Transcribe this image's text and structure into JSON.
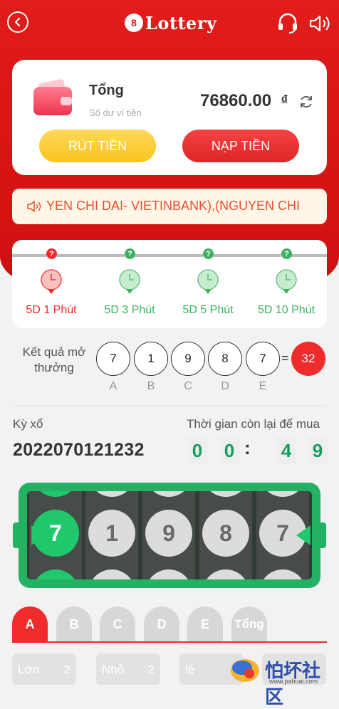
{
  "app": {
    "logo_mark": "8",
    "logo_text": "Lottery"
  },
  "wallet": {
    "title": "Tổng",
    "subtitle": "Số dư ví tiền",
    "balance": "76860.00",
    "currency": "đ",
    "withdraw_label": "RÚT TIỀN",
    "deposit_label": "NẠP TIỀN"
  },
  "notice": {
    "text": "YEN CHI DAI- VIETINBANK),(NGUYEN CHI"
  },
  "modes": [
    {
      "label": "5D 1 Phút",
      "active": true
    },
    {
      "label": "5D 3 Phút",
      "active": false
    },
    {
      "label": "5D 5 Phút",
      "active": false
    },
    {
      "label": "5D 10 Phút",
      "active": false
    }
  ],
  "modes_q": "?",
  "result": {
    "label": "Kết quả mở thưởng",
    "balls": [
      "7",
      "1",
      "9",
      "8",
      "7"
    ],
    "letters": [
      "A",
      "B",
      "C",
      "D",
      "E"
    ],
    "equals": "=",
    "sum": "32"
  },
  "period": {
    "label": "Kỳ xổ",
    "value": "2022070121232"
  },
  "timer": {
    "label": "Thời gian còn lại để mua",
    "digits": [
      "0",
      "0",
      "4",
      "9"
    ],
    "separator": ":"
  },
  "slot": {
    "values": [
      "7",
      "1",
      "9",
      "8",
      "7"
    ]
  },
  "tabs": [
    "A",
    "B",
    "C",
    "D",
    "E",
    "Tổng"
  ],
  "bets": [
    {
      "label": "Lớn",
      "odds": "2"
    },
    {
      "label": "Nhỏ",
      "odds": "2"
    },
    {
      "label": "lẻ",
      "odds": ""
    },
    {
      "label": "",
      "odds": ""
    }
  ],
  "watermark": {
    "text": "怕坏社区",
    "url": "www.pahuai.com"
  },
  "colors": {
    "primary_red": "#e31b1b",
    "accent_green": "#25b163",
    "gold": "#f8c41f"
  }
}
